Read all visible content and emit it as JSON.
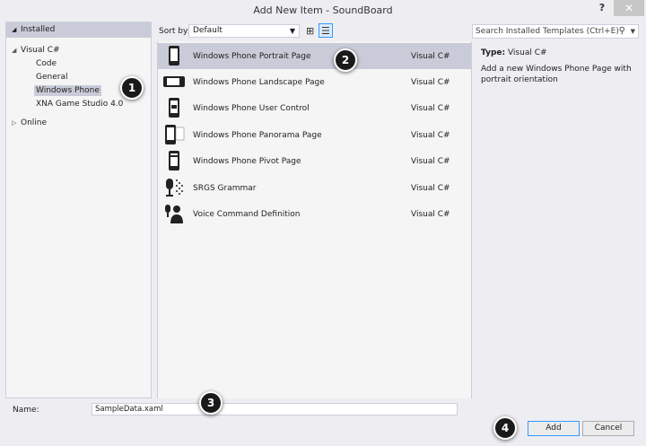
{
  "window": {
    "title": "Add New Item - SoundBoard",
    "help_label": "?",
    "close_label": "✕"
  },
  "left_panel": {
    "installed_label": "Installed",
    "tree": [
      {
        "label": "Visual C#",
        "expanded": true
      },
      {
        "label": "Code"
      },
      {
        "label": "General"
      },
      {
        "label": "Windows Phone",
        "selected": true
      },
      {
        "label": "XNA Game Studio 4.0"
      },
      {
        "label": "Online",
        "expanded": false
      }
    ]
  },
  "toolbar": {
    "sort_by_label": "Sort by:",
    "sort_value": "Default"
  },
  "search": {
    "placeholder": "Search Installed Templates (Ctrl+E)",
    "icon": "search-icon"
  },
  "templates": [
    {
      "name": "Windows Phone Portrait Page",
      "lang": "Visual C#",
      "icon": "phone-portrait-icon",
      "selected": true
    },
    {
      "name": "Windows Phone Landscape Page",
      "lang": "Visual C#",
      "icon": "phone-landscape-icon"
    },
    {
      "name": "Windows Phone User Control",
      "lang": "Visual C#",
      "icon": "phone-user-control-icon"
    },
    {
      "name": "Windows Phone Panorama Page",
      "lang": "Visual C#",
      "icon": "phone-panorama-icon"
    },
    {
      "name": "Windows Phone Pivot Page",
      "lang": "Visual C#",
      "icon": "phone-pivot-icon"
    },
    {
      "name": "SRGS Grammar",
      "lang": "Visual C#",
      "icon": "microphone-icon"
    },
    {
      "name": "Voice Command Definition",
      "lang": "Visual C#",
      "icon": "voice-person-icon"
    }
  ],
  "info": {
    "type_label": "Type:",
    "type_value": "Visual C#",
    "description": "Add a new Windows Phone Page with portrait orientation"
  },
  "bottom": {
    "name_label": "Name:",
    "name_value": "SampleData.xaml",
    "add_label": "Add",
    "cancel_label": "Cancel"
  },
  "callouts": [
    "1",
    "2",
    "3",
    "4"
  ],
  "colors": {
    "selection": "#c9ccd8",
    "callout_bg": "#1a1a1a",
    "focus_border": "#3399ff"
  }
}
